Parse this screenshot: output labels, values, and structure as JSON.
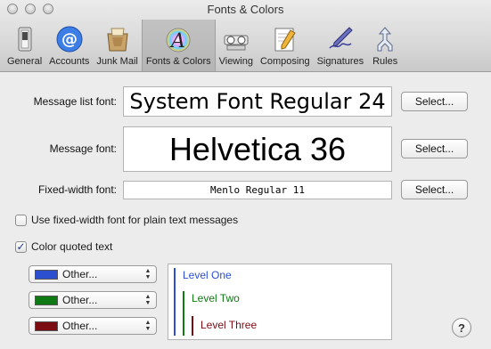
{
  "window": {
    "title": "Fonts & Colors"
  },
  "toolbar": {
    "items": [
      {
        "label": "General",
        "icon": "general-switch-icon",
        "selected": false
      },
      {
        "label": "Accounts",
        "icon": "accounts-at-icon",
        "selected": false
      },
      {
        "label": "Junk Mail",
        "icon": "junk-mail-icon",
        "selected": false
      },
      {
        "label": "Fonts & Colors",
        "icon": "fonts-colors-icon",
        "selected": true
      },
      {
        "label": "Viewing",
        "icon": "viewing-glasses-icon",
        "selected": false
      },
      {
        "label": "Composing",
        "icon": "composing-pencil-icon",
        "selected": false
      },
      {
        "label": "Signatures",
        "icon": "signatures-pen-icon",
        "selected": false
      },
      {
        "label": "Rules",
        "icon": "rules-arrows-icon",
        "selected": false
      }
    ]
  },
  "fonts": {
    "message_list": {
      "label": "Message list font:",
      "value": "System Font Regular 24",
      "button": "Select..."
    },
    "message": {
      "label": "Message font:",
      "value": "Helvetica 36",
      "button": "Select..."
    },
    "fixed_width": {
      "label": "Fixed-width font:",
      "value": "Menlo Regular 11",
      "button": "Select..."
    }
  },
  "options": {
    "fixed_width_plain": {
      "label": "Use fixed-width font for plain text messages",
      "checked": false
    },
    "color_quoted": {
      "label": "Color quoted text",
      "checked": true
    }
  },
  "quote_levels": [
    {
      "popup_label": "Other...",
      "level_label": "Level One",
      "color": "#2b4fcf"
    },
    {
      "popup_label": "Other...",
      "level_label": "Level Two",
      "color": "#0f7a14"
    },
    {
      "popup_label": "Other...",
      "level_label": "Level Three",
      "color": "#7a0c12"
    }
  ],
  "help": {
    "label": "?"
  }
}
